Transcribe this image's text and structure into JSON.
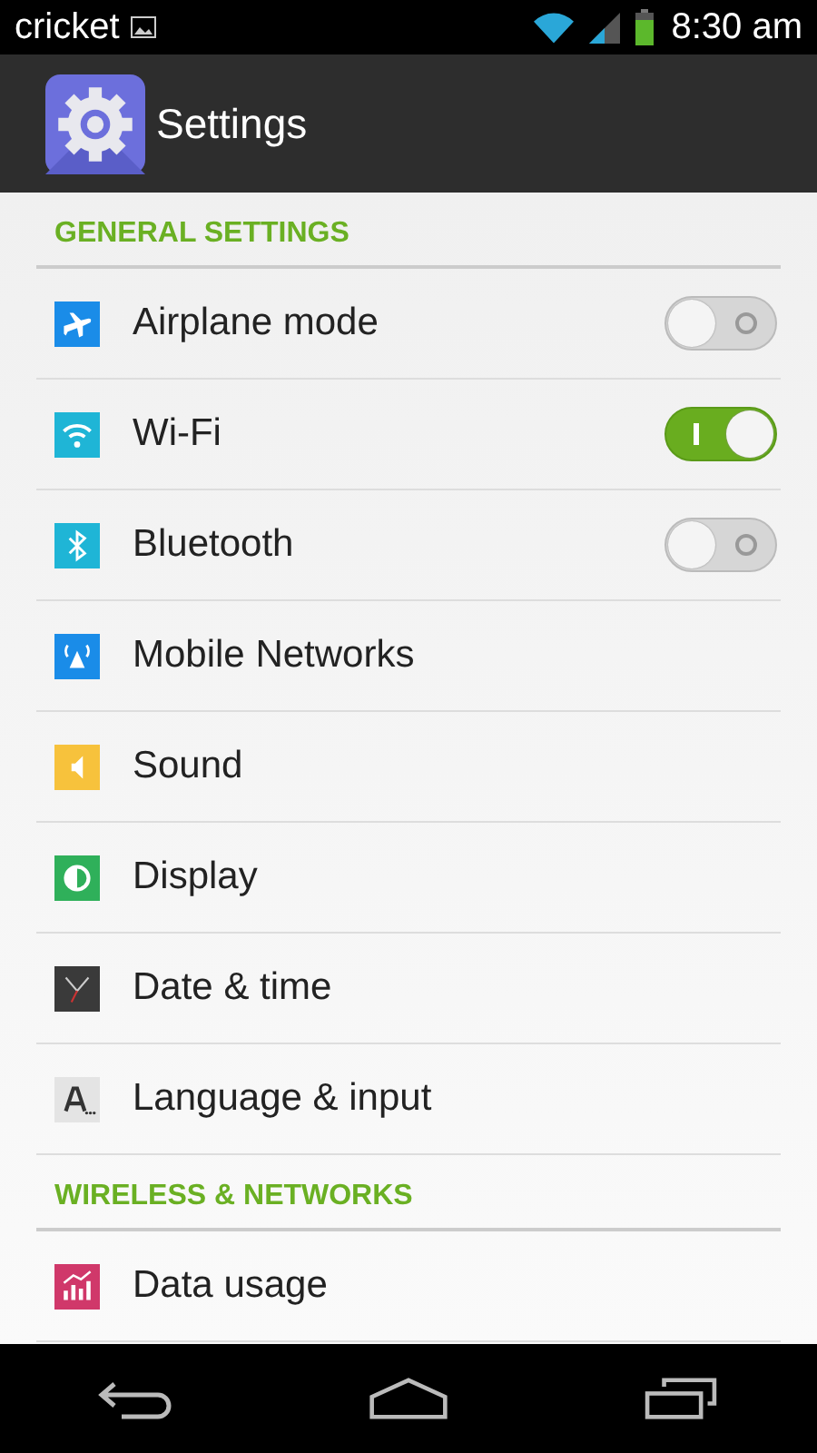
{
  "status_bar": {
    "carrier": "cricket",
    "time": "8:30 am"
  },
  "action_bar": {
    "title": "Settings"
  },
  "sections": [
    {
      "header": "GENERAL SETTINGS",
      "items": [
        {
          "label": "Airplane mode",
          "kind": "toggle",
          "on": false
        },
        {
          "label": "Wi-Fi",
          "kind": "toggle",
          "on": true
        },
        {
          "label": "Bluetooth",
          "kind": "toggle",
          "on": false
        },
        {
          "label": "Mobile Networks",
          "kind": "link"
        },
        {
          "label": "Sound",
          "kind": "link"
        },
        {
          "label": "Display",
          "kind": "link"
        },
        {
          "label": "Date & time",
          "kind": "link"
        },
        {
          "label": "Language & input",
          "kind": "link"
        }
      ]
    },
    {
      "header": "WIRELESS & NETWORKS",
      "items": [
        {
          "label": "Data usage",
          "kind": "link"
        }
      ]
    }
  ]
}
